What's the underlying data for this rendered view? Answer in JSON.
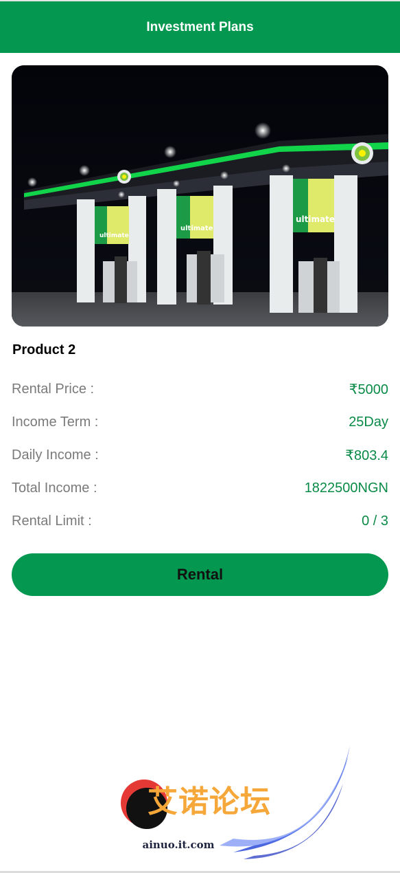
{
  "header": {
    "title": "Investment Plans"
  },
  "hero": {
    "image": "bp-fuel-station-night",
    "sign_text": "ultimate"
  },
  "product": {
    "name": "Product 2",
    "details": [
      {
        "label": "Rental Price :",
        "value": "₹5000"
      },
      {
        "label": "Income Term :",
        "value": "25Day"
      },
      {
        "label": "Daily Income :",
        "value": "₹803.4"
      },
      {
        "label": "Total Income :",
        "value": "1822500NGN"
      },
      {
        "label": "Rental Limit :",
        "value": "0 / 3"
      }
    ]
  },
  "action": {
    "rental_label": "Rental"
  },
  "watermark": {
    "text": "艾诺论坛",
    "url": "ainuo.it.com"
  },
  "colors": {
    "primary": "#03974f",
    "value_text": "#0a8a47",
    "label_text": "#7a7a7a"
  }
}
